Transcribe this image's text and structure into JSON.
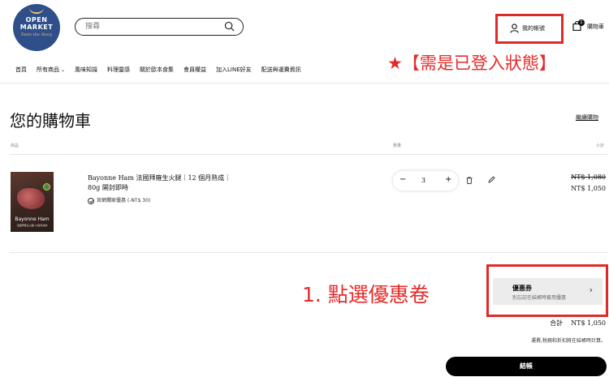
{
  "header": {
    "logo": {
      "line1": "OPEN",
      "line2": "MARKET",
      "tagline": "Taste the Story"
    },
    "search": {
      "placeholder": "搜尋"
    },
    "account_label": "我的帳號",
    "cart": {
      "label": "購物車",
      "count": "1"
    }
  },
  "nav": {
    "items": [
      {
        "label": "首頁",
        "has_dropdown": false
      },
      {
        "label": "所有商品",
        "has_dropdown": true
      },
      {
        "label": "風味知識",
        "has_dropdown": false
      },
      {
        "label": "料理靈感",
        "has_dropdown": false
      },
      {
        "label": "關於歐本食集",
        "has_dropdown": false
      },
      {
        "label": "會員權益",
        "has_dropdown": false
      },
      {
        "label": "加入LINE好友",
        "has_dropdown": false
      },
      {
        "label": "配送與運費資訊",
        "has_dropdown": false
      }
    ]
  },
  "annotations": {
    "login_note": "★【需是已登入狀態】",
    "step1": "1. 點選優惠卷",
    "color": "#e52a2a"
  },
  "cart_page": {
    "title": "您的購物車",
    "continue_shopping": "繼續購物",
    "columns": {
      "product": "商品",
      "quantity": "數量",
      "subtotal": "小計"
    },
    "items": [
      {
        "image_title": "Bayonne Ham",
        "image_subtitle": "法國拜雍生火腿 12個月熟成",
        "name": "Bayonne Ham 法國拜雍生火腿｜12 個月熟成｜80g 開封即時",
        "promo": "官網獨家優惠 (-NT$ 30)",
        "quantity": "3",
        "price_original": "NT$ 1,080",
        "price_final": "NT$ 1,050"
      }
    ],
    "coupon": {
      "title": "優惠券",
      "subtitle": "別忘記在結帳時套用優惠"
    },
    "total_label": "合計",
    "total_value": "NT$ 1,050",
    "tax_note": "運費,稅務和折扣將在結帳時計算。",
    "checkout_label": "結帳"
  }
}
